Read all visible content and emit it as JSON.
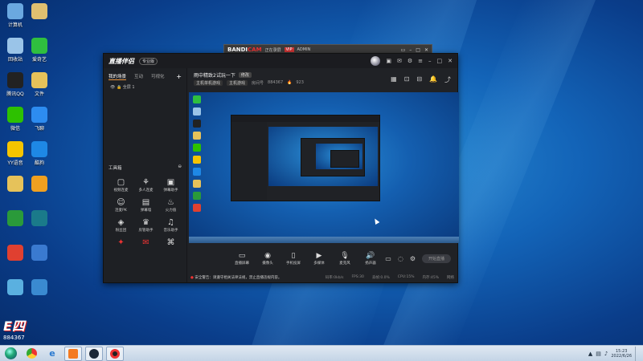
{
  "desktop_icons": [
    {
      "label": "计算机",
      "icon": "computer-icon",
      "color": "#6aa8e0"
    },
    {
      "label": "",
      "icon": "file-icon",
      "color": "#e0c070"
    },
    {
      "label": "回收站",
      "icon": "recycle-bin-icon",
      "color": "#9ac4e8"
    },
    {
      "label": "爱奇艺",
      "icon": "iqiyi-icon",
      "color": "#2fbf3f"
    },
    {
      "label": "腾讯QQ",
      "icon": "qq-icon",
      "color": "#222222"
    },
    {
      "label": "文件",
      "icon": "folder-icon",
      "color": "#e6c25a"
    },
    {
      "label": "微信",
      "icon": "wechat-icon",
      "color": "#2dc100"
    },
    {
      "label": "飞聊",
      "icon": "app-icon",
      "color": "#2d8cf0"
    },
    {
      "label": "YY语音",
      "icon": "yy-icon",
      "color": "#f5c400"
    },
    {
      "label": "酷狗",
      "icon": "kugou-icon",
      "color": "#1e88e5"
    },
    {
      "label": "",
      "icon": "folder-icon",
      "color": "#e6c25a"
    },
    {
      "label": "",
      "icon": "app-icon",
      "color": "#f0a020"
    },
    {
      "label": "",
      "icon": "app-icon",
      "color": "#2a9a3a"
    },
    {
      "label": "",
      "icon": "app-icon",
      "color": "#1a7a8a"
    },
    {
      "label": "",
      "icon": "app-icon",
      "color": "#e04030"
    },
    {
      "label": "",
      "icon": "app-icon",
      "color": "#3a7ad0"
    },
    {
      "label": "",
      "icon": "app-icon",
      "color": "#5ab0e0"
    },
    {
      "label": "",
      "icon": "app-icon",
      "color": "#3a8ad0"
    }
  ],
  "bandicam": {
    "logo_a": "BANDI",
    "logo_b": "CAM",
    "subtitle": "正在录屏",
    "vip": "VIP",
    "extra": "ADMIN"
  },
  "app": {
    "brand": "直播伴侣",
    "tag": "专业版",
    "sidebar": {
      "tabs": [
        "我的场景",
        "互动",
        "可视化"
      ],
      "scene": "全屏 1",
      "tools_title": "工具箱",
      "tools": [
        {
          "label": "视频连麦",
          "icon": "video-connect-icon"
        },
        {
          "label": "多人连麦",
          "icon": "multi-connect-icon"
        },
        {
          "label": "弹幕助手",
          "icon": "danmaku-icon"
        },
        {
          "label": "连麦PK",
          "icon": "pk-icon"
        },
        {
          "label": "弹幕墙",
          "icon": "danmaku-wall-icon"
        },
        {
          "label": "火力值",
          "icon": "fire-icon"
        },
        {
          "label": "粉丝团",
          "icon": "fans-icon"
        },
        {
          "label": "房管助手",
          "icon": "manager-icon"
        },
        {
          "label": "音乐助手",
          "icon": "music-icon"
        },
        {
          "label": "",
          "icon": "gift-icon",
          "red": true
        },
        {
          "label": "",
          "icon": "chat-icon",
          "red": true
        },
        {
          "label": "",
          "icon": "game-icon",
          "red": false
        }
      ]
    },
    "stream": {
      "title": "雨中精致2试玩一下",
      "edit_label": "修改",
      "category": "主机单机游戏",
      "category2": "主机游戏",
      "room_label": "房间号",
      "room_value": "884367",
      "fans_value": "923"
    },
    "controls": [
      {
        "label": "直播屏幕",
        "icon": "screen-share-icon"
      },
      {
        "label": "摄像头",
        "icon": "camera-icon"
      },
      {
        "label": "手机投屏",
        "icon": "phone-cast-icon"
      },
      {
        "label": "多媒体",
        "icon": "media-icon"
      },
      {
        "label": "麦克风",
        "icon": "microphone-icon"
      },
      {
        "label": "扬声器",
        "icon": "speaker-icon"
      }
    ],
    "start_button": "开始直播",
    "status": {
      "warning": "安全警告：请遵守相关法律法规，禁止直播违规内容。",
      "bitrate": "码率:0kb/s",
      "fps": "FPS:30",
      "dropped": "丢帧:0.0%",
      "cpu": "CPU:15%",
      "memory": "内存:45%",
      "network": "网络"
    }
  },
  "overlay_badge": {
    "big": "E四",
    "num": "884367"
  },
  "clock": {
    "time": "15:23",
    "date": "2022/6/26"
  },
  "colors": {
    "accent": "#e94f4f",
    "desktop": "#1364b8",
    "app_bg": "#202226"
  }
}
